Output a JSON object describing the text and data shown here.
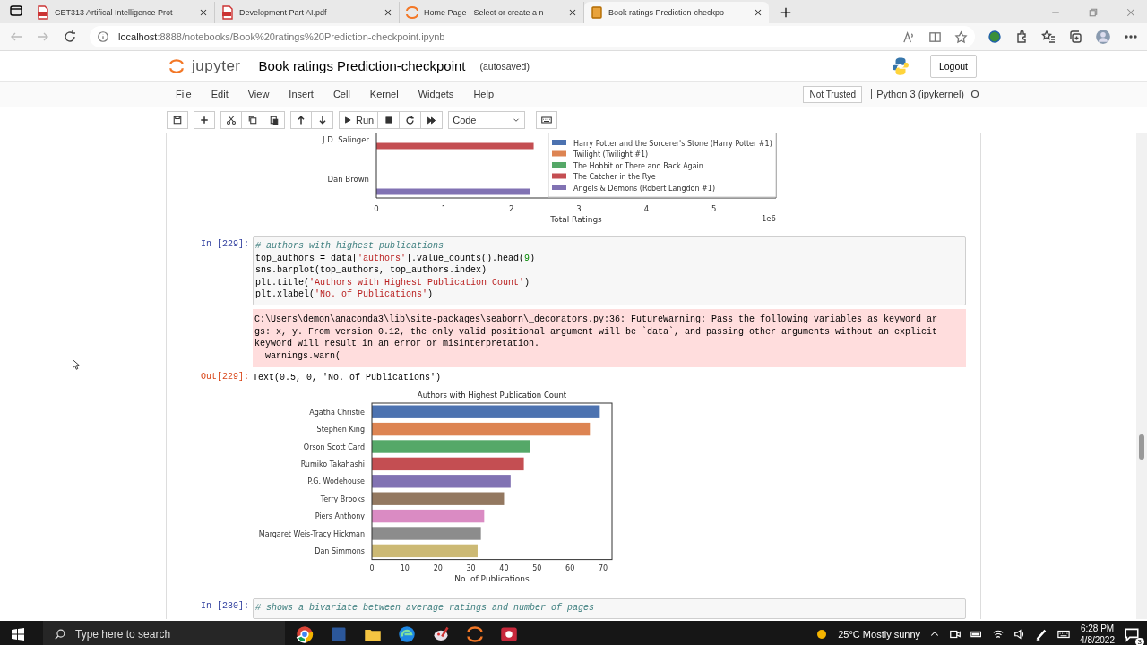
{
  "browser": {
    "tabs": [
      {
        "title": "CET313 Artifical Intelligence Prot",
        "kind": "pdf",
        "selected": false
      },
      {
        "title": "Development Part AI.pdf",
        "kind": "pdf",
        "selected": false
      },
      {
        "title": "Home Page - Select or create a n",
        "kind": "jupyter",
        "selected": false
      },
      {
        "title": "Book ratings Prediction-checkpo",
        "kind": "book",
        "selected": true
      }
    ],
    "url_host": "localhost",
    "url_rest": ":8888/notebooks/Book%20ratings%20Prediction-checkpoint.ipynb"
  },
  "jupyter": {
    "logo_text": "jupyter",
    "title": "Book ratings Prediction-checkpoint",
    "save_status": "(autosaved)",
    "logout": "Logout",
    "menu": [
      "File",
      "Edit",
      "View",
      "Insert",
      "Cell",
      "Kernel",
      "Widgets",
      "Help"
    ],
    "trusted": "Not Trusted",
    "kernel": "Python 3 (ipykernel)",
    "toolbar": {
      "run": "Run",
      "cell_type": "Code"
    }
  },
  "cells": [
    {
      "kind": "figure",
      "chart_data": {
        "type": "bar",
        "orientation": "horizontal",
        "xlabel": "Total Ratings",
        "annotations": [
          {
            "text": "1e6"
          }
        ],
        "legend": "lower right",
        "categories": [
          "J.D. Salinger",
          "Dan Brown"
        ],
        "xlim": [
          0,
          5.92
        ],
        "xticks": [
          0,
          1,
          2,
          3,
          4,
          5
        ],
        "series": [
          {
            "name": "Harry Potter and the Sorcerer's Stone (Harry Potter  #1)",
            "color": "#4c72b0",
            "values": [
              null,
              null
            ]
          },
          {
            "name": "Twilight (Twilight  #1)",
            "color": "#dd8452",
            "values": [
              null,
              null
            ]
          },
          {
            "name": "The Hobbit or There and Back Again",
            "color": "#55a868",
            "values": [
              null,
              null
            ]
          },
          {
            "name": "The Catcher in the Rye",
            "color": "#c44e52",
            "values": [
              2.33,
              null
            ]
          },
          {
            "name": "Angels & Demons (Robert Langdon  #1)",
            "color": "#8172b3",
            "values": [
              null,
              2.28
            ]
          }
        ]
      }
    },
    {
      "kind": "code",
      "prompt": "In [229]:",
      "source": "# authors with highest publications\ntop_authors = data['authors'].value_counts().head(9)\nsns.barplot(top_authors, top_authors.index)\nplt.title('Authors with Highest Publication Count')\nplt.xlabel('No. of Publications')"
    },
    {
      "kind": "stderr",
      "text": "C:\\Users\\demon\\anaconda3\\lib\\site-packages\\seaborn\\_decorators.py:36: FutureWarning: Pass the following variables as keyword ar\ngs: x, y. From version 0.12, the only valid positional argument will be `data`, and passing other arguments without an explicit\nkeyword will result in an error or misinterpretation.\n  warnings.warn("
    },
    {
      "kind": "result",
      "prompt": "Out[229]:",
      "text": "Text(0.5, 0, 'No. of Publications')"
    },
    {
      "kind": "figure",
      "chart_data": {
        "type": "bar",
        "orientation": "horizontal",
        "title": "Authors with Highest Publication Count",
        "xlabel": "No. of Publications",
        "categories": [
          "Agatha Christie",
          "Stephen King",
          "Orson Scott Card",
          "Rumiko Takahashi",
          "P.G. Wodehouse",
          "Terry Brooks",
          "Piers Anthony",
          "Margaret Weis-Tracy Hickman",
          "Dan Simmons"
        ],
        "values": [
          69,
          66,
          48,
          46,
          42,
          40,
          34,
          33,
          32
        ],
        "colors": [
          "#4c72b0",
          "#dd8452",
          "#55a868",
          "#c44e52",
          "#8172b3",
          "#937860",
          "#da8bc3",
          "#8c8c8c",
          "#ccb974"
        ],
        "xlim": [
          0,
          72.7
        ],
        "xticks": [
          0,
          10,
          20,
          30,
          40,
          50,
          60,
          70
        ]
      }
    },
    {
      "kind": "code",
      "prompt": "In [230]:",
      "source": "# shows a bivariate between average ratings and number of pages"
    }
  ],
  "taskbar": {
    "search": "Type here to search",
    "weather": "25°C Mostly sunny",
    "time": "6:28 PM",
    "date": "4/8/2022",
    "notifications": "3"
  }
}
